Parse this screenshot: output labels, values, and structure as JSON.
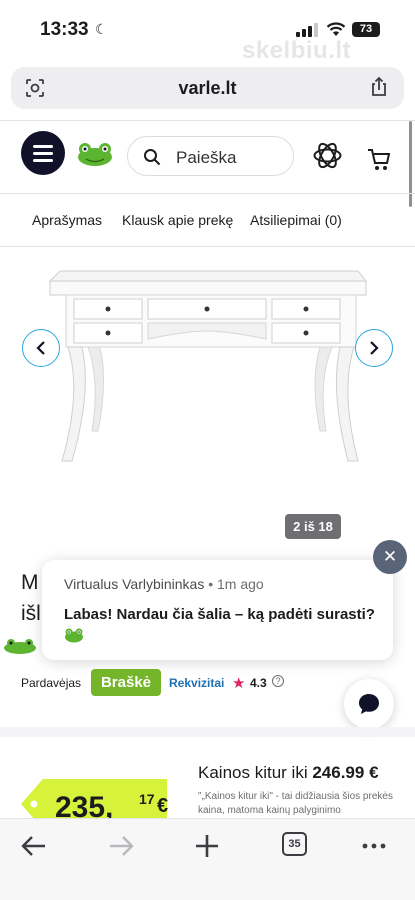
{
  "status_bar": {
    "time": "13:33",
    "battery": "73",
    "watermark": "skelbiu.lt"
  },
  "browser": {
    "url": "varle.lt",
    "tab_count": "35"
  },
  "header": {
    "search_placeholder": "Paieška"
  },
  "tabs": [
    {
      "label": "Aprašymas"
    },
    {
      "label": "Klausk apie prekę"
    },
    {
      "label": "Atsiliepimai (0)"
    }
  ],
  "gallery": {
    "counter": "2 iš 18"
  },
  "product": {
    "title_fragment_1": "M",
    "title_fragment_2": "išl"
  },
  "chat": {
    "sender": "Virtualus Varlybininkas",
    "time": "• 1m ago",
    "message": "Labas! Nardau čia šalia – ką padėti surasti?",
    "close_icon": "close-icon"
  },
  "seller": {
    "label": "Pardavėjas",
    "name": "Braškė",
    "requisites": "Rekvizitai",
    "rating": "4.3"
  },
  "price": {
    "main": "235,",
    "cents": "17",
    "currency": "€",
    "elsewhere_label": "Kainos kitur iki",
    "elsewhere_value": "246.99 €",
    "note": "\"„Kainos kitur iki\" - tai didžiausia šios prekės kaina, matoma kainų palyginimo"
  },
  "colors": {
    "accent": "#2aa7e0",
    "seller_badge": "#75b529",
    "price_tag": "#d7f23a",
    "nav_dark": "#12112a"
  }
}
